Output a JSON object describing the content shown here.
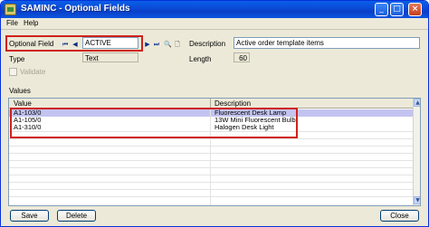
{
  "window": {
    "title": "SAMINC - Optional Fields",
    "controls": {
      "minimize": "_",
      "maximize": "□",
      "close": "×"
    }
  },
  "menu": {
    "file": "File",
    "help": "Help"
  },
  "form": {
    "optional_field_label": "Optional Field",
    "optional_field_value": "ACTIVE",
    "description_label": "Description",
    "description_value": "Active order template items",
    "type_label": "Type",
    "type_value": "Text",
    "length_label": "Length",
    "length_value": "60",
    "validate_label": "Validate",
    "values_label": "Values"
  },
  "navigation_icons": [
    "first-record-icon",
    "previous-record-icon",
    "next-record-icon",
    "last-record-icon",
    "finder-icon",
    "new-document-icon"
  ],
  "grid": {
    "columns": [
      "Value",
      "Description"
    ],
    "rows": [
      {
        "value": "A1-103/0",
        "description": "Fluorescent Desk Lamp",
        "selected": true
      },
      {
        "value": "A1-105/0",
        "description": "13W Mini Fluorescent Bulb",
        "selected": false
      },
      {
        "value": "A1-310/0",
        "description": "Halogen Desk Light",
        "selected": false
      }
    ]
  },
  "buttons": {
    "save": "Save",
    "delete": "Delete",
    "close": "Close"
  },
  "colors": {
    "title_bar": "#0a4ad6",
    "highlight": "#d0221b",
    "selected_row": "#c3c3f0"
  }
}
